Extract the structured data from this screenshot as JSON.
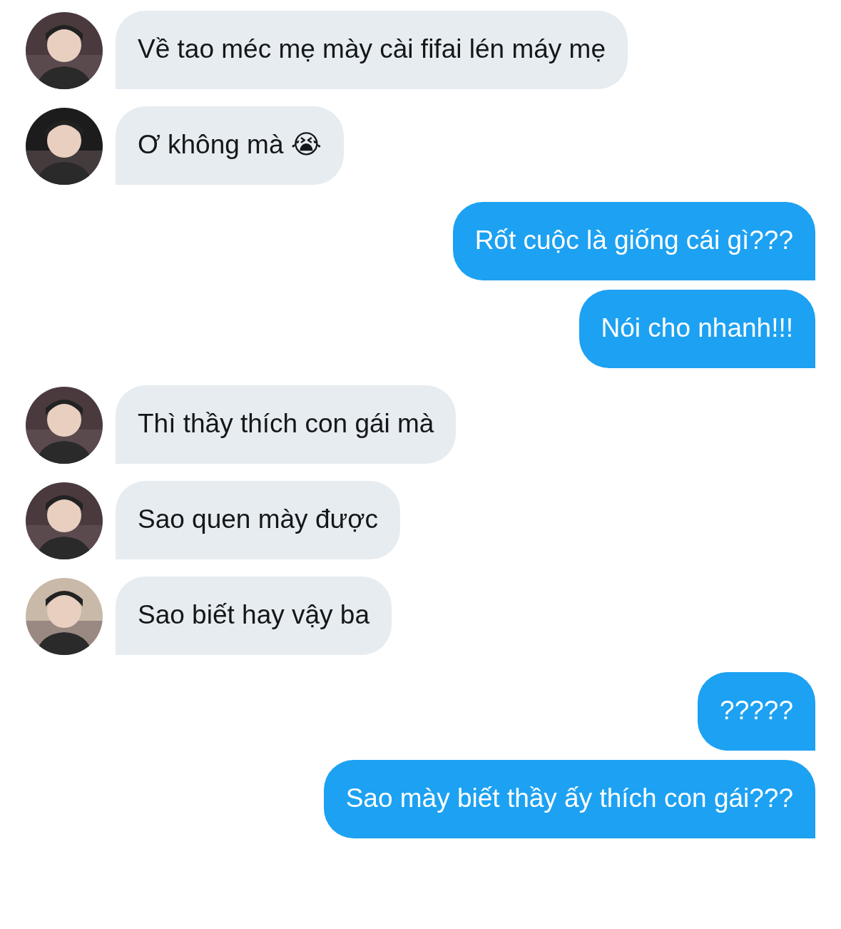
{
  "messages": [
    {
      "kind": "received",
      "text": "Về tao méc mẹ mày cài fifai lén máy mẹ"
    },
    {
      "kind": "received",
      "text": "Ơ không mà 😭"
    },
    {
      "kind": "sent",
      "text": "Rốt cuộc là giống cái gì???"
    },
    {
      "kind": "sent",
      "text": "Nói cho nhanh!!!"
    },
    {
      "kind": "received",
      "text": "Thì thầy thích con gái mà"
    },
    {
      "kind": "received",
      "text": "Sao quen mày được"
    },
    {
      "kind": "received",
      "text": "Sao biết hay vậy ba"
    },
    {
      "kind": "sent",
      "text": "?????"
    },
    {
      "kind": "sent",
      "text": "Sao mày biết thầy ấy thích con gái???"
    }
  ]
}
